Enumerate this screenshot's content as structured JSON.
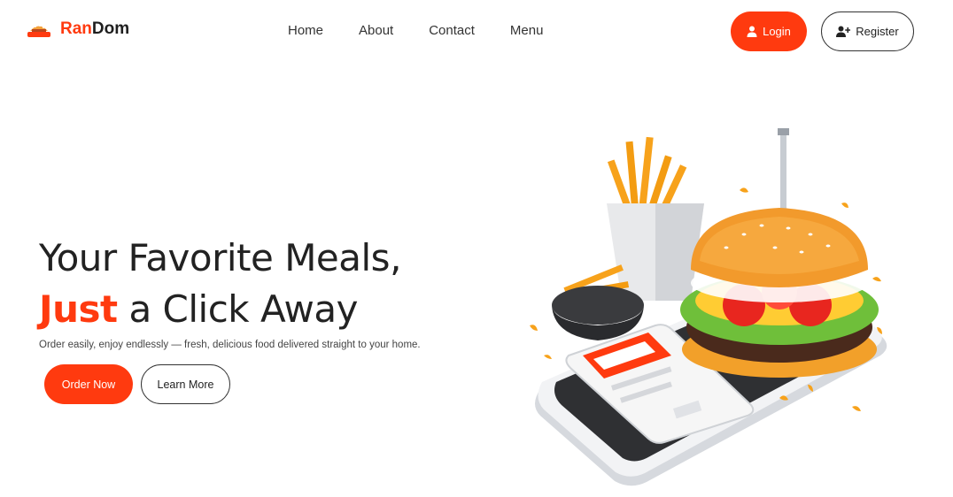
{
  "brand": {
    "name_part1": "Ran",
    "name_part2": "Dom",
    "logo_icon": "food-tray-icon"
  },
  "nav": {
    "links": [
      "Home",
      "About",
      "Contact",
      "Menu"
    ]
  },
  "auth": {
    "login_label": "Login",
    "register_label": "Register",
    "login_icon": "user-icon",
    "register_icon": "user-plus-icon"
  },
  "hero": {
    "title_line1": "Your Favorite Meals,",
    "title_highlight": "Just",
    "title_line2_rest": " a Click Away",
    "subtitle": "Order easily, enjoy endlessly — fresh, delicious food delivered straight to your home.",
    "order_label": "Order Now",
    "learn_label": "Learn More"
  },
  "colors": {
    "accent": "#ff3a0f",
    "text": "#222222",
    "background": "#ffffff"
  }
}
